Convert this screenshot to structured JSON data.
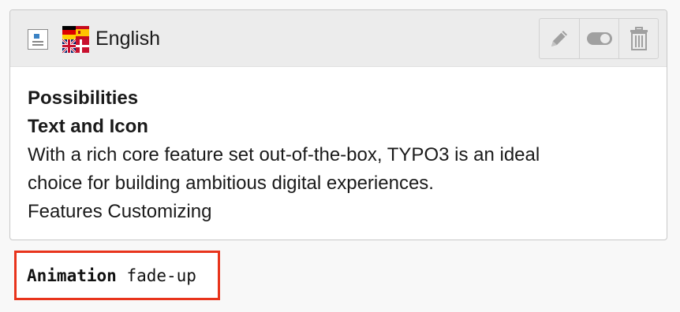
{
  "header": {
    "language": "English",
    "page_icon": "page-content-icon",
    "flag_icon": "german-spanish-uk-danish-flags-icon",
    "actions": [
      {
        "name": "edit",
        "icon": "pencil-icon"
      },
      {
        "name": "toggle",
        "icon": "toggle-icon"
      },
      {
        "name": "delete",
        "icon": "trash-icon"
      }
    ]
  },
  "content": {
    "heading": "Possibilities",
    "subheading": "Text and Icon",
    "body_line1": "With a rich core feature set out-of-the-box, TYPO3 is an ideal",
    "body_line2": "choice for building ambitious digital experiences.",
    "body_line3": "Features Customizing"
  },
  "animation": {
    "label": "Animation",
    "value": "fade-up"
  },
  "colors": {
    "highlight_border": "#e8341c",
    "header_bg": "#ececec",
    "icon_gray": "#9a9a9a"
  }
}
